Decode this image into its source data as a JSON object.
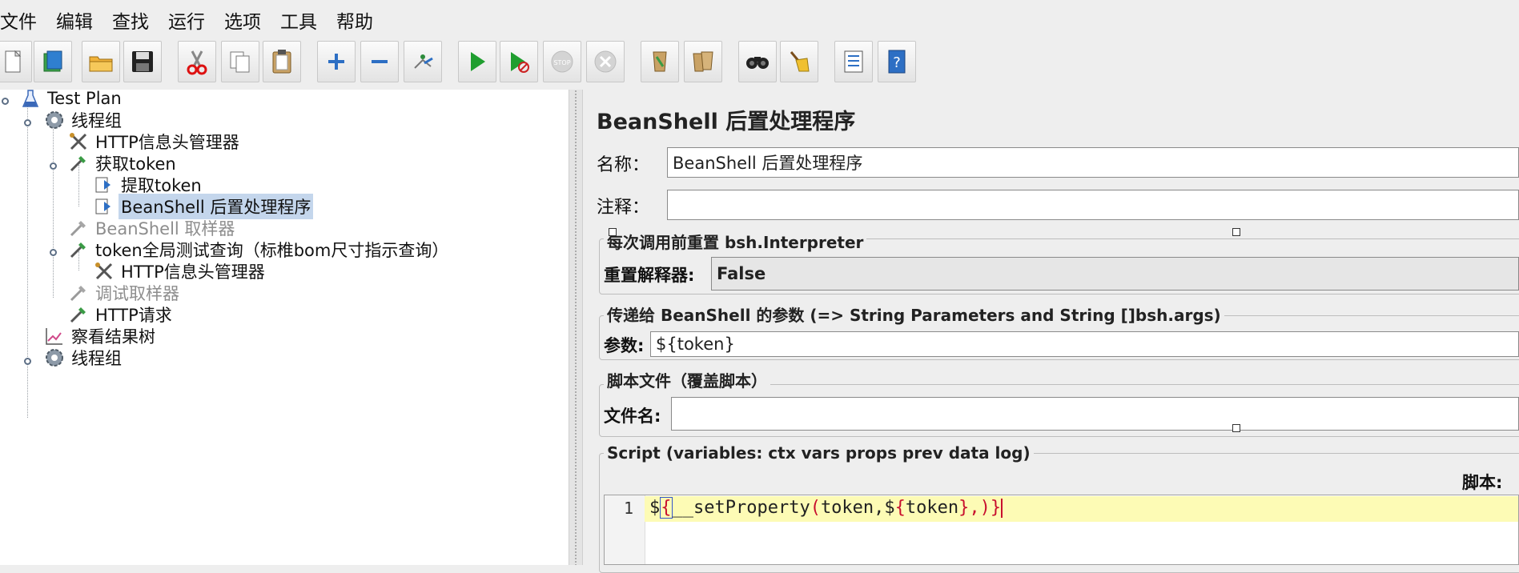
{
  "menubar": {
    "items": [
      "文件",
      "编辑",
      "查找",
      "运行",
      "选项",
      "工具",
      "帮助"
    ]
  },
  "toolbar": {
    "buttons": [
      "new-icon",
      "templates-icon",
      "open-icon",
      "save-icon",
      "cut-icon",
      "copy-icon",
      "paste-icon",
      "expand-icon",
      "collapse-icon",
      "toggle-icon",
      "start-icon",
      "start-no-pause-icon",
      "stop-icon",
      "shutdown-icon",
      "clear-icon",
      "clear-all-icon",
      "search-icon",
      "reset-search-icon",
      "function-helper-icon",
      "help-icon"
    ]
  },
  "tree": {
    "items": [
      {
        "label": "Test Plan",
        "icon": "test-plan-icon",
        "state": "normal"
      },
      {
        "label": "线程组",
        "icon": "gear-icon",
        "state": "normal"
      },
      {
        "label": "HTTP信息头管理器",
        "icon": "tools-icon",
        "state": "normal"
      },
      {
        "label": "获取token",
        "icon": "sampler-icon",
        "state": "normal"
      },
      {
        "label": "提取token",
        "icon": "processor-icon",
        "state": "normal"
      },
      {
        "label": "BeanShell 后置处理程序",
        "icon": "processor-icon",
        "state": "selected"
      },
      {
        "label": "BeanShell 取样器",
        "icon": "sampler-icon",
        "state": "disabled"
      },
      {
        "label": "token全局测试查询（标椎bom尺寸指示查询）",
        "icon": "sampler-icon",
        "state": "normal"
      },
      {
        "label": "HTTP信息头管理器",
        "icon": "tools-icon",
        "state": "normal"
      },
      {
        "label": "调试取样器",
        "icon": "sampler-icon",
        "state": "disabled"
      },
      {
        "label": "HTTP请求",
        "icon": "sampler-icon",
        "state": "normal"
      },
      {
        "label": "察看结果树",
        "icon": "chart-icon",
        "state": "normal"
      },
      {
        "label": "线程组",
        "icon": "gear-icon",
        "state": "normal"
      }
    ]
  },
  "panel": {
    "title": "BeanShell 后置处理程序",
    "name_label": "名称：",
    "name_value": "BeanShell 后置处理程序",
    "comment_label": "注释：",
    "comment_value": "",
    "reset_group_title": "每次调用前重置 bsh.Interpreter",
    "reset_label": "重置解释器:",
    "reset_value": "False",
    "params_group_title": "传递给 BeanShell 的参数 (=> String Parameters and String []bsh.args)",
    "params_label": "参数:",
    "params_value": "${token}",
    "file_group_title": "脚本文件（覆盖脚本）",
    "file_label": "文件名:",
    "file_value": "",
    "script_group_title": "Script (variables: ctx vars props prev data log)",
    "script_label": "脚本:",
    "line_number": "1",
    "code": {
      "p1": "$",
      "p2": "{",
      "p3": "__setProperty",
      "p4": "(",
      "p5": "token,$",
      "p6": "{",
      "p7": "token",
      "p8": "},)}"
    }
  },
  "colors": {
    "selected_bg": "#c4d6ec",
    "code_line_bg": "#fdfbb5",
    "code_red": "#c8102e",
    "code_text": "#222222"
  }
}
